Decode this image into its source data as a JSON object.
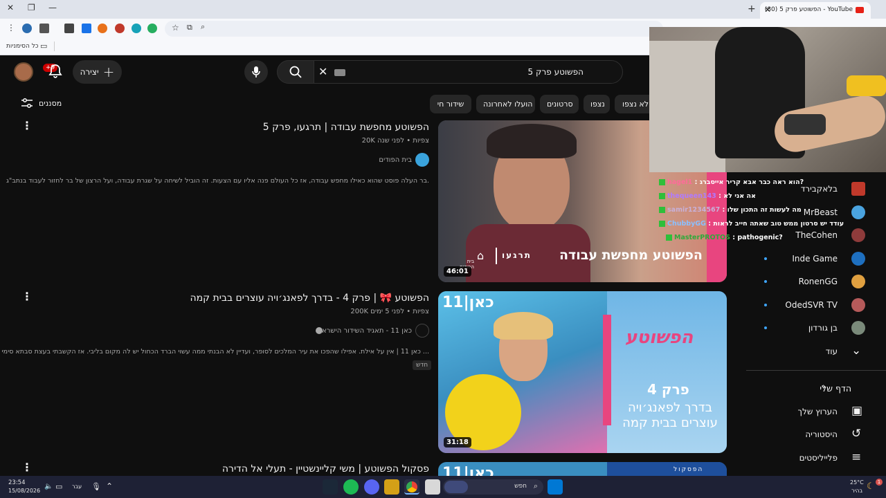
{
  "browser": {
    "tab_title": "(80) הפשוטע פרק 5 - YouTube",
    "bookmarks_label": "כל הסימניות"
  },
  "header": {
    "search_query": "הפשוטע פרק 5",
    "create_label": "יצירה",
    "notif_count": "+9"
  },
  "filters": {
    "label": "מסננים",
    "chips": [
      "לא נצפו",
      "נצפו",
      "סרטונים",
      "הועלו לאחרונה",
      "שידור חי"
    ]
  },
  "results": [
    {
      "title": "הפשוטע מחפשת עבודה | תרגעו, פרק 5",
      "views_age": "20K צפיות • לפני שנה",
      "channel": "בית הפודים",
      "description": "בר העלה פוסט שהוא כאילו מחפש עבודה, אז כל העולם פנה אליו עם הצעות. זה הוביל לשיחה על שגרת עבודה, ועל הרצון של בר לחזור לעבוד בנתב\"ג.",
      "duration": "46:01",
      "thumb_text": "הפשוטע מחפשת עבודה",
      "thumb_brand": "תרגעו",
      "thumb_brand2": "בית הפודים"
    },
    {
      "title": "הפשוטע 🎀 | פרק 4 - בדרך לפאנג׳ויה עוצרים בבית קמה",
      "views_age": "200K צפיות • לפני 5 ימים",
      "channel": "כאן 11 - תאגיד השידור הישראלי",
      "description": "כאן 11 | אין על אילת. אפילו שהפכו את עיר המלכים לסופר, ועדיין לא הבנתי ממה עשוי הברד הכחול יש לה מקום בליבי. אז הקשבתי בעצת סבתא סימי ...",
      "badge": "חדש",
      "duration": "31:18",
      "thumb_logo": "כאן|11",
      "thumb_title": "הפשוטע",
      "thumb_text1": "פרק 4",
      "thumb_text2": "בדרך לפאנג׳ויה עוצרים בבית קמה"
    },
    {
      "title": "פסקול הפשוטע | משי קליינשטיין - תעלי אל הדירה",
      "thumb_logo": "כאן|11",
      "thumb_tag": "הפסקול"
    }
  ],
  "sidebar": {
    "subscriptions": [
      {
        "name": "בלאקבירד",
        "color": "#c0392b",
        "dot": false
      },
      {
        "name": "MrBeast",
        "color": "#4aa3df",
        "dot": false
      },
      {
        "name": "TheCohen",
        "color": "#8e3b3b",
        "dot": false
      },
      {
        "name": "Inde Game",
        "color": "#1e6fbf",
        "dot": true
      },
      {
        "name": "RonenGG",
        "color": "#e0a040",
        "dot": true
      },
      {
        "name": "OdedSVR TV",
        "color": "#b55a5a",
        "dot": true
      },
      {
        "name": "בן גורדון",
        "color": "#7a8a7a",
        "dot": true
      }
    ],
    "more_label": "עוד",
    "my_page_label": "הדף שלי",
    "my_channel": "הערוץ שלך",
    "history": "היסטוריה",
    "playlists": "פלייליסטים"
  },
  "chat": [
    {
      "user": "hagel1",
      "msg": "הוא ראה כבר אבא קריר אייסברג?"
    },
    {
      "user": "thequeen143",
      "msg": "אה אני לא"
    },
    {
      "user": "samir1234567",
      "msg": "מה לעשות זה התכון שלו"
    },
    {
      "user": "ChubbyGG",
      "msg": "עודד יש סרטון ממש טוב שאתה חייב לראות"
    },
    {
      "user": "MasterPROTOS",
      "msg": "pathogenic?"
    }
  ],
  "taskbar": {
    "time": "23:54",
    "date": "15/08/2026",
    "lang": "עבר",
    "search": "חפש",
    "weather_temp": "25°C",
    "weather_desc": "בהיר"
  }
}
